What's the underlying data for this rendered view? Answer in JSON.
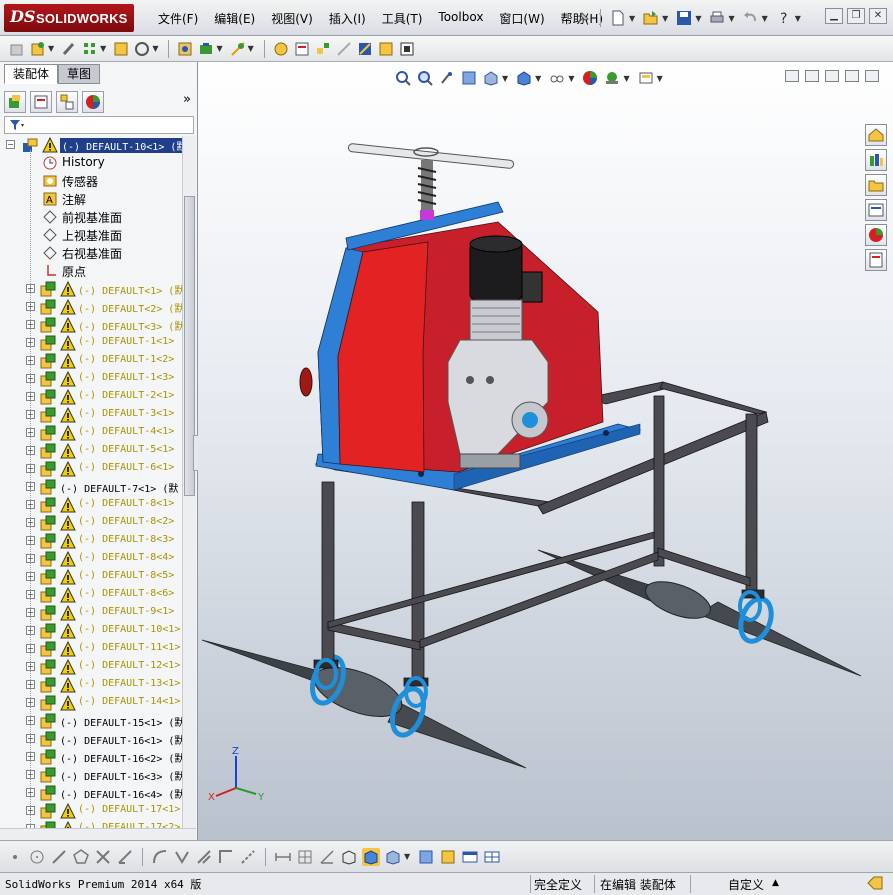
{
  "app": {
    "logo_ds": "DS",
    "logo_name": "SOLIDWORKS"
  },
  "menu": [
    "文件(F)",
    "编辑(E)",
    "视图(V)",
    "插入(I)",
    "工具(T)",
    "Toolbox",
    "窗口(W)",
    "帮助(H)"
  ],
  "tabs": {
    "assembly": "装配体",
    "sketch": "草图"
  },
  "tree": {
    "root_label": "(-) DEFAULT-10<1> (默认",
    "features": [
      "History",
      "传感器",
      "注解",
      "前视基准面",
      "上视基准面",
      "右视基准面",
      "原点"
    ],
    "components": [
      {
        "label": "(-) DEFAULT<1> (默",
        "warn": true
      },
      {
        "label": "(-) DEFAULT<2> (默",
        "warn": true
      },
      {
        "label": "(-) DEFAULT<3> (默",
        "warn": true
      },
      {
        "label": "(-) DEFAULT-1<1>",
        "warn": true
      },
      {
        "label": "(-) DEFAULT-1<2>",
        "warn": true
      },
      {
        "label": "(-) DEFAULT-1<3>",
        "warn": true
      },
      {
        "label": "(-) DEFAULT-2<1>",
        "warn": true
      },
      {
        "label": "(-) DEFAULT-3<1>",
        "warn": true
      },
      {
        "label": "(-) DEFAULT-4<1>",
        "warn": true
      },
      {
        "label": "(-) DEFAULT-5<1>",
        "warn": true
      },
      {
        "label": "(-) DEFAULT-6<1>",
        "warn": true
      },
      {
        "label": "(-) DEFAULT-7<1> (默",
        "warn": false
      },
      {
        "label": "(-) DEFAULT-8<1>",
        "warn": true
      },
      {
        "label": "(-) DEFAULT-8<2>",
        "warn": true
      },
      {
        "label": "(-) DEFAULT-8<3>",
        "warn": true
      },
      {
        "label": "(-) DEFAULT-8<4>",
        "warn": true
      },
      {
        "label": "(-) DEFAULT-8<5>",
        "warn": true
      },
      {
        "label": "(-) DEFAULT-8<6>",
        "warn": true
      },
      {
        "label": "(-) DEFAULT-9<1>",
        "warn": true
      },
      {
        "label": "(-) DEFAULT-10<1>",
        "warn": true
      },
      {
        "label": "(-) DEFAULT-11<1>",
        "warn": true
      },
      {
        "label": "(-) DEFAULT-12<1>",
        "warn": true
      },
      {
        "label": "(-) DEFAULT-13<1>",
        "warn": true
      },
      {
        "label": "(-) DEFAULT-14<1>",
        "warn": true
      },
      {
        "label": "(-) DEFAULT-15<1> (默",
        "warn": false
      },
      {
        "label": "(-) DEFAULT-16<1> (默",
        "warn": false
      },
      {
        "label": "(-) DEFAULT-16<2> (默",
        "warn": false
      },
      {
        "label": "(-) DEFAULT-16<3> (默",
        "warn": false
      },
      {
        "label": "(-) DEFAULT-16<4> (默",
        "warn": false
      },
      {
        "label": "(-) DEFAULT-17<1>",
        "warn": true
      },
      {
        "label": "(-) DEFAULT-17<2>",
        "warn": true
      }
    ]
  },
  "triad": {
    "z": "Z",
    "x": "X",
    "y": "Y"
  },
  "status": {
    "product": "SolidWorks Premium 2014 x64 版",
    "definition": "完全定义",
    "editing": "在编辑 装配体",
    "custom": "自定义"
  },
  "colors": {
    "warning": "#f2d000",
    "housing_red": "#d42020",
    "plate_blue": "#2e7fd6",
    "frame_gray": "#4a4a50",
    "selection": "#1f3f8a"
  }
}
